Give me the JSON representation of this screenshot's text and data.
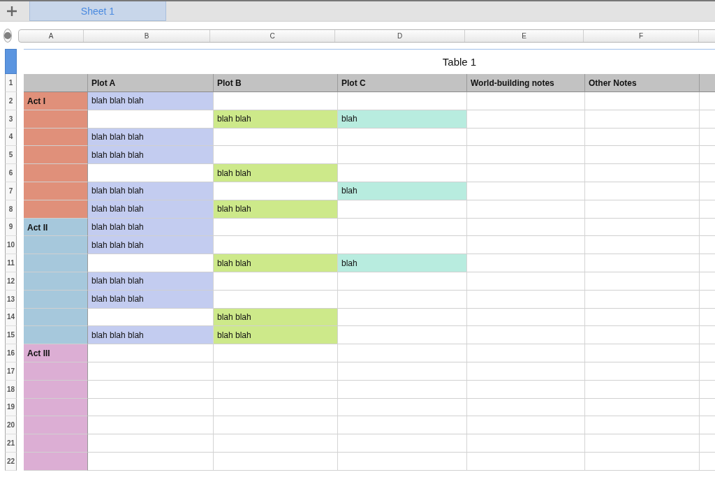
{
  "sheet_tabs": [
    {
      "label": "Sheet 1",
      "selected": true
    }
  ],
  "column_letters": [
    "A",
    "B",
    "C",
    "D",
    "E",
    "F"
  ],
  "table": {
    "title": "Table 1",
    "columns": [
      {},
      {
        "label": "Plot A"
      },
      {
        "label": "Plot B"
      },
      {
        "label": "Plot C"
      },
      {
        "label": "World-building notes"
      },
      {
        "label": "Other Notes"
      },
      {}
    ],
    "rows": [
      {
        "number": "1",
        "header": true
      },
      {
        "number": "2",
        "cells": [
          {
            "text": "Act I",
            "color": "#e0907a"
          },
          {
            "text": "blah blah blah",
            "color": "#c3ccf0"
          },
          {},
          {},
          {},
          {},
          {}
        ]
      },
      {
        "number": "3",
        "cells": [
          {
            "color": "#e0907a"
          },
          {},
          {
            "text": "blah blah",
            "color": "#cde98a"
          },
          {
            "text": "blah",
            "color": "#b8ecdf"
          },
          {},
          {},
          {}
        ]
      },
      {
        "number": "4",
        "cells": [
          {
            "color": "#e0907a"
          },
          {
            "text": "blah blah blah",
            "color": "#c3ccf0"
          },
          {},
          {},
          {},
          {},
          {}
        ]
      },
      {
        "number": "5",
        "cells": [
          {
            "color": "#e0907a"
          },
          {
            "text": "blah blah blah",
            "color": "#c3ccf0"
          },
          {},
          {},
          {},
          {},
          {}
        ]
      },
      {
        "number": "6",
        "cells": [
          {
            "color": "#e0907a"
          },
          {},
          {
            "text": "blah blah",
            "color": "#cde98a"
          },
          {},
          {},
          {},
          {}
        ]
      },
      {
        "number": "7",
        "cells": [
          {
            "color": "#e0907a"
          },
          {
            "text": "blah blah blah",
            "color": "#c3ccf0"
          },
          {},
          {
            "text": "blah",
            "color": "#b8ecdf"
          },
          {},
          {},
          {}
        ]
      },
      {
        "number": "8",
        "cells": [
          {
            "color": "#e0907a"
          },
          {
            "text": "blah blah blah",
            "color": "#c3ccf0"
          },
          {
            "text": "blah blah",
            "color": "#cde98a"
          },
          {},
          {},
          {},
          {}
        ]
      },
      {
        "number": "9",
        "cells": [
          {
            "text": "Act II",
            "color": "#a6c8dc"
          },
          {
            "text": "blah blah blah",
            "color": "#c3ccf0"
          },
          {},
          {},
          {},
          {},
          {}
        ]
      },
      {
        "number": "10",
        "cells": [
          {
            "color": "#a6c8dc"
          },
          {
            "text": "blah blah blah",
            "color": "#c3ccf0"
          },
          {},
          {},
          {},
          {},
          {}
        ]
      },
      {
        "number": "11",
        "cells": [
          {
            "color": "#a6c8dc"
          },
          {},
          {
            "text": "blah blah",
            "color": "#cde98a"
          },
          {
            "text": "blah",
            "color": "#b8ecdf"
          },
          {},
          {},
          {}
        ]
      },
      {
        "number": "12",
        "cells": [
          {
            "color": "#a6c8dc"
          },
          {
            "text": "blah blah blah",
            "color": "#c3ccf0"
          },
          {},
          {},
          {},
          {},
          {}
        ]
      },
      {
        "number": "13",
        "cells": [
          {
            "color": "#a6c8dc"
          },
          {
            "text": "blah blah blah",
            "color": "#c3ccf0"
          },
          {},
          {},
          {},
          {},
          {}
        ]
      },
      {
        "number": "14",
        "cells": [
          {
            "color": "#a6c8dc"
          },
          {},
          {
            "text": "blah blah",
            "color": "#cde98a"
          },
          {},
          {},
          {},
          {}
        ]
      },
      {
        "number": "15",
        "cells": [
          {
            "color": "#a6c8dc"
          },
          {
            "text": "blah blah blah",
            "color": "#c3ccf0"
          },
          {
            "text": "blah blah",
            "color": "#cde98a"
          },
          {},
          {},
          {},
          {}
        ]
      },
      {
        "number": "16",
        "cells": [
          {
            "text": "Act III",
            "color": "#dcaed4"
          },
          {},
          {},
          {},
          {},
          {},
          {}
        ]
      },
      {
        "number": "17",
        "cells": [
          {
            "color": "#dcaed4"
          },
          {},
          {},
          {},
          {},
          {},
          {}
        ]
      },
      {
        "number": "18",
        "cells": [
          {
            "color": "#dcaed4"
          },
          {},
          {},
          {},
          {},
          {},
          {}
        ]
      },
      {
        "number": "19",
        "cells": [
          {
            "color": "#dcaed4"
          },
          {},
          {},
          {},
          {},
          {},
          {}
        ]
      },
      {
        "number": "20",
        "cells": [
          {
            "color": "#dcaed4"
          },
          {},
          {},
          {},
          {},
          {},
          {}
        ]
      },
      {
        "number": "21",
        "cells": [
          {
            "color": "#dcaed4"
          },
          {},
          {},
          {},
          {},
          {},
          {}
        ]
      },
      {
        "number": "22",
        "cells": [
          {
            "color": "#dcaed4"
          },
          {},
          {},
          {},
          {},
          {},
          {}
        ]
      }
    ]
  }
}
